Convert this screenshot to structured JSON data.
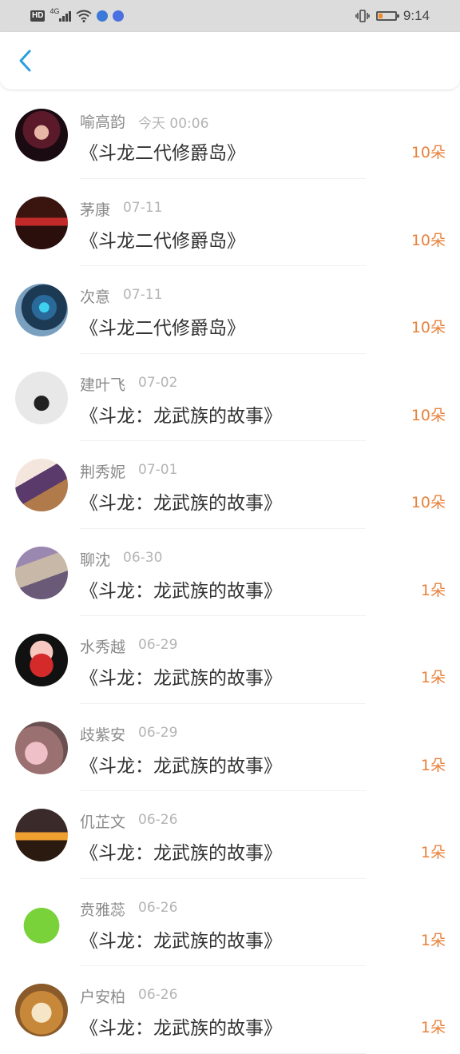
{
  "status_bar": {
    "hd": "HD",
    "network": "4G",
    "time": "9:14",
    "battery_level": 0.25,
    "battery_color": "#f08a24"
  },
  "header": {
    "back_icon": "chevron-left-icon",
    "accent": "#2a9fe0"
  },
  "gift_color": "#e8823c",
  "records": [
    {
      "name": "喻高韵",
      "time": "今天 00:06",
      "title": "《斗龙二代修爵岛》",
      "count": "10朵",
      "avatar": "portrait-dark-red"
    },
    {
      "name": "茅康",
      "time": "07-11",
      "title": "《斗龙二代修爵岛》",
      "count": "10朵",
      "avatar": "portrait-red-banner"
    },
    {
      "name": "次意",
      "time": "07-11",
      "title": "《斗龙二代修爵岛》",
      "count": "10朵",
      "avatar": "robot-blue"
    },
    {
      "name": "建叶飞",
      "time": "07-02",
      "title": "《斗龙：龙武族的故事》",
      "count": "10朵",
      "avatar": "sketch-girl"
    },
    {
      "name": "荆秀妮",
      "time": "07-01",
      "title": "《斗龙：龙武族的故事》",
      "count": "10朵",
      "avatar": "anime-girl"
    },
    {
      "name": "聊沈",
      "time": "06-30",
      "title": "《斗龙：龙武族的故事》",
      "count": "1朵",
      "avatar": "cat-purple"
    },
    {
      "name": "水秀越",
      "time": "06-29",
      "title": "《斗龙：龙武族的故事》",
      "count": "1朵",
      "avatar": "cartoon-pig"
    },
    {
      "name": "歧紫安",
      "time": "06-29",
      "title": "《斗龙：龙武族的故事》",
      "count": "1朵",
      "avatar": "pink-blur"
    },
    {
      "name": "仉芷文",
      "time": "06-26",
      "title": "《斗龙：龙武族的故事》",
      "count": "1朵",
      "avatar": "sunset-boat"
    },
    {
      "name": "贲雅蕊",
      "time": "06-26",
      "title": "《斗龙：龙武族的故事》",
      "count": "1朵",
      "avatar": "green-pig"
    },
    {
      "name": "户安柏",
      "time": "06-26",
      "title": "《斗龙：龙武族的故事》",
      "count": "1朵",
      "avatar": "shiba-dog"
    }
  ]
}
